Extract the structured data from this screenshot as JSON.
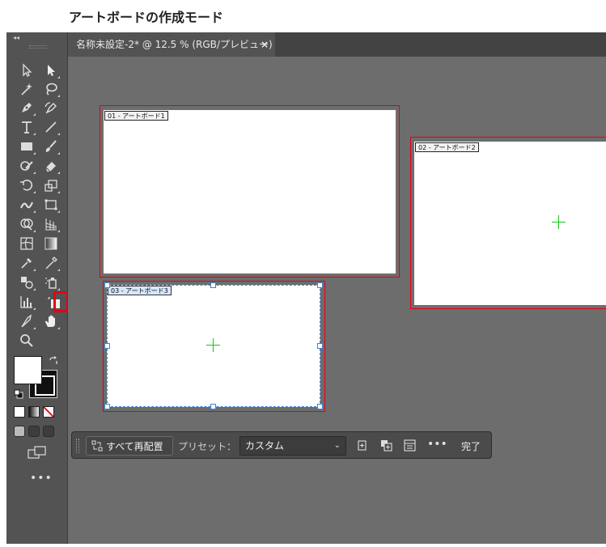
{
  "heading": "アートボードの作成モード",
  "document_tab": {
    "title": "名称未設定-2* @ 12.5 % (RGB/プレビュー)",
    "close_glyph": "×"
  },
  "toolbar": {
    "collapse_glyph": "◂◂",
    "more_glyph": "•••",
    "tools": [
      "selection-tool",
      "direct-selection-tool",
      "magic-wand-tool",
      "lasso-tool",
      "pen-tool",
      "curvature-tool",
      "type-tool",
      "line-segment-tool",
      "rectangle-tool",
      "paintbrush-tool",
      "shaper-tool",
      "eraser-tool",
      "rotate-tool",
      "scale-tool",
      "width-tool",
      "free-transform-tool",
      "shape-builder-tool",
      "perspective-grid-tool",
      "mesh-tool",
      "gradient-tool",
      "eyedropper-tool",
      "measure-tool",
      "blend-tool",
      "symbol-sprayer-tool",
      "column-graph-tool",
      "artboard-tool",
      "slice-tool",
      "hand-tool",
      "zoom-tool"
    ],
    "active_tool": "artboard-tool",
    "fill_color": "#ffffff",
    "stroke_color": "#000000",
    "highlight_color": "#e60012"
  },
  "artboards": [
    {
      "label": "01 - アートボード1",
      "selected": false
    },
    {
      "label": "02 - アートボード2",
      "selected": false
    },
    {
      "label": "03 - アートボード3",
      "selected": true
    }
  ],
  "control_bar": {
    "rearrange_label": "すべて再配置",
    "preset_label": "プリセット：",
    "preset_value": "カスタム",
    "done_label": "完了",
    "more_glyph": "•••"
  },
  "colors": {
    "canvas": "#6d6d6d",
    "panel": "#535353",
    "artboard_outline": "#e60012",
    "selection": "#3a84d6",
    "center_mark": "#19c419"
  }
}
